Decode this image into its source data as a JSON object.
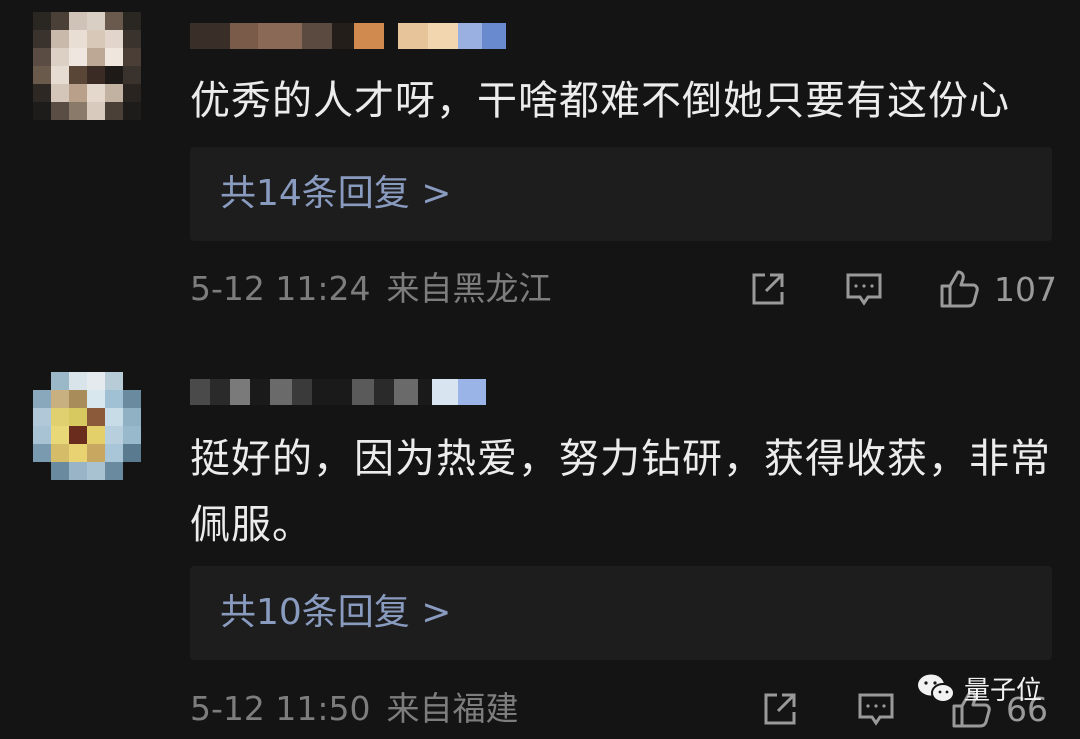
{
  "comments": [
    {
      "text": "优秀的人才呀，干啥都难不倒她只要有这份心",
      "reply_label": "共14条回复 >",
      "time": "5-12 11:24",
      "location": "来自黑龙江",
      "likes": "107"
    },
    {
      "text": "挺好的，因为热爱，努力钻研，获得收获，非常佩服。",
      "reply_label": "共10条回复 >",
      "time": "5-12 11:50",
      "location": "来自福建",
      "likes": "66"
    }
  ],
  "watermark": {
    "label": "量子位",
    "icon": "wechat-icon"
  },
  "icons": {
    "share": "share-icon",
    "comment": "comment-icon",
    "like": "thumbs-up-icon"
  },
  "colors": {
    "background": "#141414",
    "reply_link": "#8a9bc0",
    "meta_text": "#7d7d7d",
    "reply_box": "#1d1d1d"
  }
}
